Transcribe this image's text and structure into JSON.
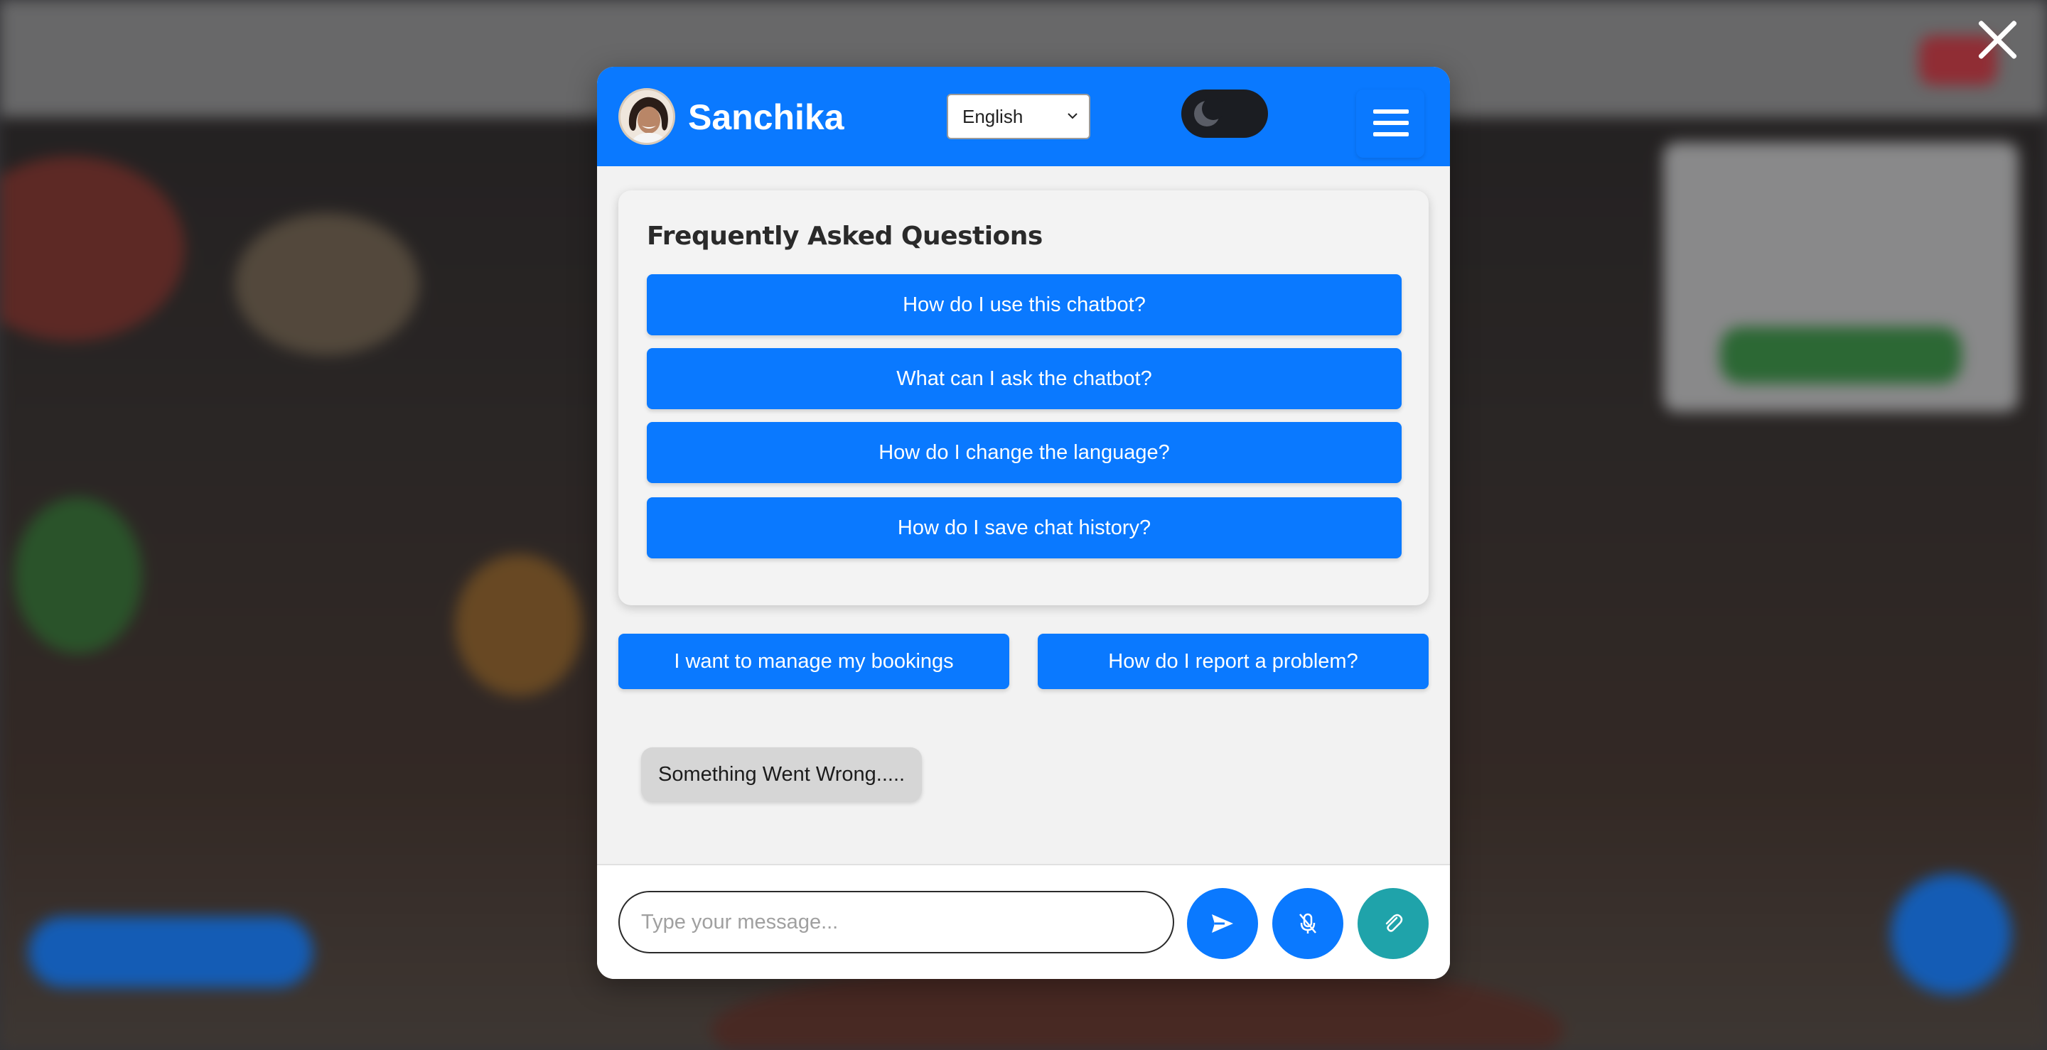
{
  "chat": {
    "bot_name": "Sanchika",
    "language": {
      "selected": "English"
    },
    "faq": {
      "title": "Frequently Asked Questions",
      "questions": [
        "How do I use this chatbot?",
        "What can I ask the chatbot?",
        "How do I change the language?",
        "How do I save chat history?"
      ]
    },
    "quick_replies": [
      "I want to manage my bookings",
      "How do I report a problem?"
    ],
    "messages": [
      {
        "from": "bot",
        "text": "Something Went Wrong....."
      }
    ],
    "input": {
      "placeholder": "Type your message..."
    },
    "icons": {
      "close": "close-icon",
      "language_dropdown": "chevron-down-icon",
      "theme": "moon-icon",
      "menu": "hamburger-icon",
      "send": "send-icon",
      "mic": "microphone-off-icon",
      "attach": "paperclip-icon"
    }
  },
  "colors": {
    "accent": "#0a79ff",
    "attach_button": "#1fa3aa",
    "bot_bubble": "#d6d6d6",
    "panel": "#f2f2f2"
  }
}
